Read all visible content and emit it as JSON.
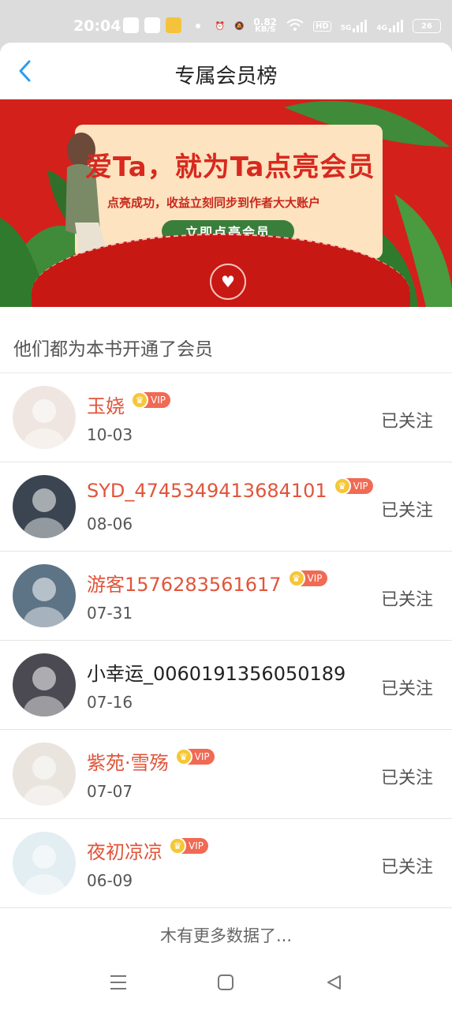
{
  "status_bar": {
    "time": "20:04",
    "net_speed_value": "0.82",
    "net_speed_unit": "KB/S",
    "hd_label": "HD",
    "signal1_label": "5G",
    "signal2_label": "4G",
    "battery": "26"
  },
  "header": {
    "title": "专属会员榜",
    "back_icon": "chevron-left-icon"
  },
  "banner": {
    "title": "爱Ta，就为Ta点亮会员",
    "subtitle": "点亮成功，收益立刻同步到作者大大账户",
    "button_label": "立即点亮会员",
    "colors": {
      "background": "#d4201b",
      "card": "#fde3c0",
      "button": "#3a7e3c"
    }
  },
  "section_title": "他们都为本书开通了会员",
  "members": [
    {
      "name": "玉娆",
      "vip": true,
      "vip_label": "VIP",
      "date": "10-03",
      "follow_label": "已关注",
      "avatar_color": "#f0e6e1"
    },
    {
      "name": "SYD_4745349413684101",
      "vip": true,
      "vip_label": "VIP",
      "date": "08-06",
      "follow_label": "已关注",
      "avatar_color": "#3a4551"
    },
    {
      "name": "游客1576283561617",
      "vip": true,
      "vip_label": "VIP",
      "date": "07-31",
      "follow_label": "已关注",
      "avatar_color": "#5d7386"
    },
    {
      "name": "小幸运_0060191356050189",
      "vip": false,
      "vip_label": "",
      "date": "07-16",
      "follow_label": "已关注",
      "avatar_color": "#4b4a52"
    },
    {
      "name": "紫苑·雪殇",
      "vip": true,
      "vip_label": "VIP",
      "date": "07-07",
      "follow_label": "已关注",
      "avatar_color": "#e9e4de"
    },
    {
      "name": "夜初凉凉",
      "vip": true,
      "vip_label": "VIP",
      "date": "06-09",
      "follow_label": "已关注",
      "avatar_color": "#e3eef2"
    }
  ],
  "footer_text": "木有更多数据了...",
  "nav_bar": {
    "menu_icon": "menu-icon",
    "home_icon": "home-square-icon",
    "back_icon": "back-triangle-icon"
  },
  "colors": {
    "accent": "#2a9df4",
    "vip_name": "#e0553b",
    "vip_badge": "#f06a54"
  }
}
